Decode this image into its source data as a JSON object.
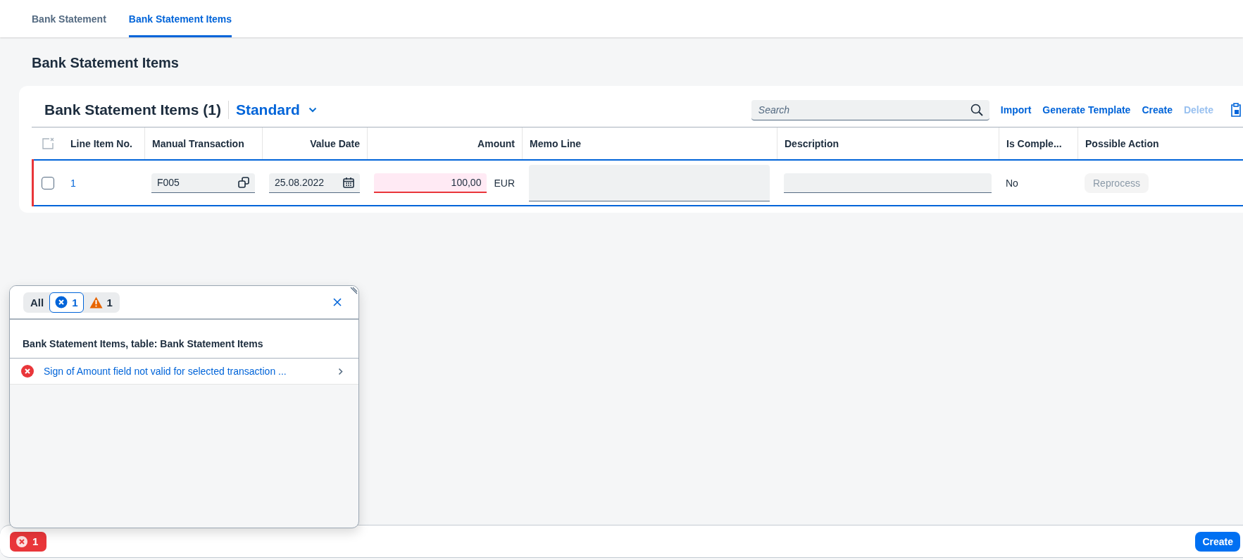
{
  "tabs": [
    {
      "label": "Bank Statement",
      "selected": false
    },
    {
      "label": "Bank Statement Items",
      "selected": true
    }
  ],
  "page_title": "Bank Statement Items",
  "table": {
    "title": "Bank Statement Items (1)",
    "variant": "Standard",
    "search": {
      "placeholder": "Search"
    },
    "actions": [
      {
        "label": "Import",
        "disabled": false
      },
      {
        "label": "Generate Template",
        "disabled": false
      },
      {
        "label": "Create",
        "disabled": false
      },
      {
        "label": "Delete",
        "disabled": true
      }
    ],
    "columns": [
      "Line Item No.",
      "Manual Transaction",
      "Value Date",
      "Amount",
      "Memo Line",
      "Description",
      "Is Comple...",
      "Possible Action"
    ],
    "rows": [
      {
        "selected": false,
        "error": true,
        "line_item_no": "1",
        "manual_transaction": "F005",
        "value_date": "25.08.2022",
        "amount": "100,00",
        "currency": "EUR",
        "is_completed": "No",
        "possible_action": {
          "label": "Reprocess",
          "disabled": true
        }
      }
    ]
  },
  "message_popover": {
    "filters": [
      {
        "kind": "all",
        "label": "All",
        "selected": false
      },
      {
        "kind": "error",
        "count": "1",
        "selected": true
      },
      {
        "kind": "warning",
        "count": "1",
        "selected": false
      }
    ],
    "group_title": "Bank Statement Items, table: Bank Statement Items",
    "messages": [
      {
        "kind": "error",
        "text": "Sign of Amount field not valid for selected transaction ..."
      }
    ]
  },
  "footer": {
    "error_count": "1",
    "primary_button": "Create"
  }
}
